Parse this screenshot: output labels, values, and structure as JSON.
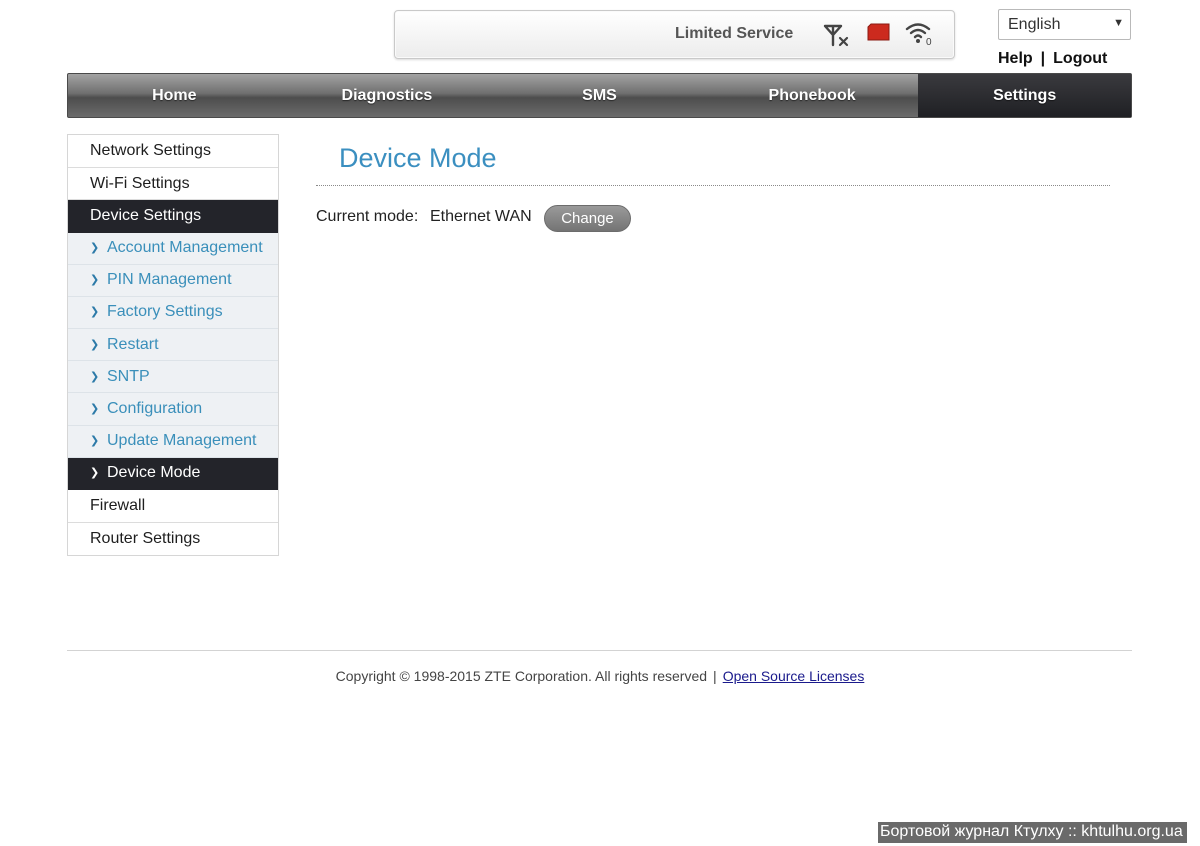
{
  "status": {
    "service_text": "Limited Service",
    "icons": [
      "no-signal-icon",
      "sim-card-icon",
      "wifi-icon"
    ],
    "wifi_clients": "0"
  },
  "header": {
    "language": "English",
    "help_label": "Help",
    "separator": "|",
    "logout_label": "Logout"
  },
  "nav": {
    "items": [
      {
        "label": "Home"
      },
      {
        "label": "Diagnostics"
      },
      {
        "label": "SMS"
      },
      {
        "label": "Phonebook"
      },
      {
        "label": "Settings",
        "active": true
      }
    ]
  },
  "sidebar": {
    "items": [
      {
        "label": "Network Settings"
      },
      {
        "label": "Wi-Fi Settings"
      },
      {
        "label": "Device Settings",
        "active": true
      },
      {
        "label": "Firewall"
      },
      {
        "label": "Router Settings"
      }
    ],
    "subitems": [
      {
        "label": "Account Management"
      },
      {
        "label": "PIN Management"
      },
      {
        "label": "Factory Settings"
      },
      {
        "label": "Restart"
      },
      {
        "label": "SNTP"
      },
      {
        "label": "Configuration"
      },
      {
        "label": "Update Management"
      },
      {
        "label": "Device Mode",
        "active": true
      }
    ]
  },
  "content": {
    "title": "Device Mode",
    "current_mode_label": "Current mode:",
    "current_mode_value": "Ethernet WAN",
    "change_button": "Change"
  },
  "footer": {
    "copyright": "Copyright © 1998-2015 ZTE Corporation. All rights reserved",
    "separator": "|",
    "licenses_link": "Open Source Licenses"
  },
  "watermark": "Бортовой журнал Ктулху :: khtulhu.org.ua",
  "colors": {
    "accent": "#3b8fc0",
    "nav_active": "#23242a",
    "sim_red": "#cc2a1e"
  }
}
